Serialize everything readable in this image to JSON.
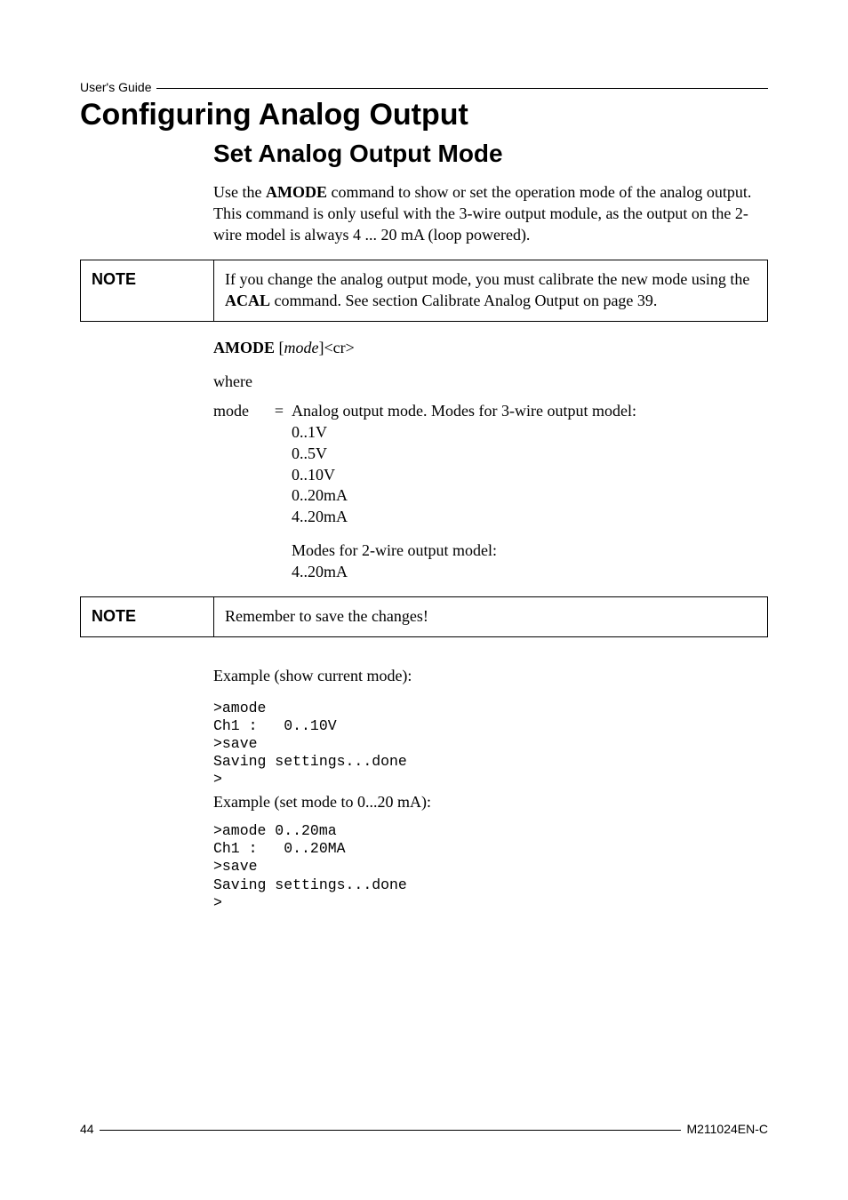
{
  "running_head": "User's Guide",
  "title": "Configuring Analog Output",
  "subtitle": "Set Analog Output Mode",
  "intro": {
    "pre": "Use the ",
    "cmd": "AMODE",
    "post": " command to show or set the operation mode of the analog output. This command is only useful with the 3-wire output module, as the output on the 2-wire model is always 4 ... 20 mA (loop powered)."
  },
  "note1": {
    "label": "NOTE",
    "text_pre": "If you change the analog output mode, you must calibrate the new mode using the ",
    "cmd": "ACAL",
    "text_post": " command. See section Calibrate Analog Output on page 39."
  },
  "syntax": {
    "cmd": "AMODE",
    "arg": "mode",
    "tail": "<cr>"
  },
  "where_label": "where",
  "param": {
    "name": "mode",
    "eq": "=",
    "desc_line": "Analog output mode. Modes for 3-wire output model:",
    "modes3": "0..1V\n0..5V\n0..10V\n0..20mA\n4..20mA",
    "desc2": "Modes for 2-wire output model:",
    "modes2": "4..20mA"
  },
  "note2": {
    "label": "NOTE",
    "text": "Remember to save the changes!"
  },
  "example1_label": "Example (show current mode):",
  "example1_code": ">amode\nCh1 :   0..10V\n>save\nSaving settings...done\n>",
  "example2_label": "Example (set mode to 0...20 mA):",
  "example2_code": ">amode 0..20ma\nCh1 :   0..20MA\n>save\nSaving settings...done\n>",
  "footer": {
    "page": "44",
    "doc": "M211024EN-C"
  },
  "chart_data": null
}
